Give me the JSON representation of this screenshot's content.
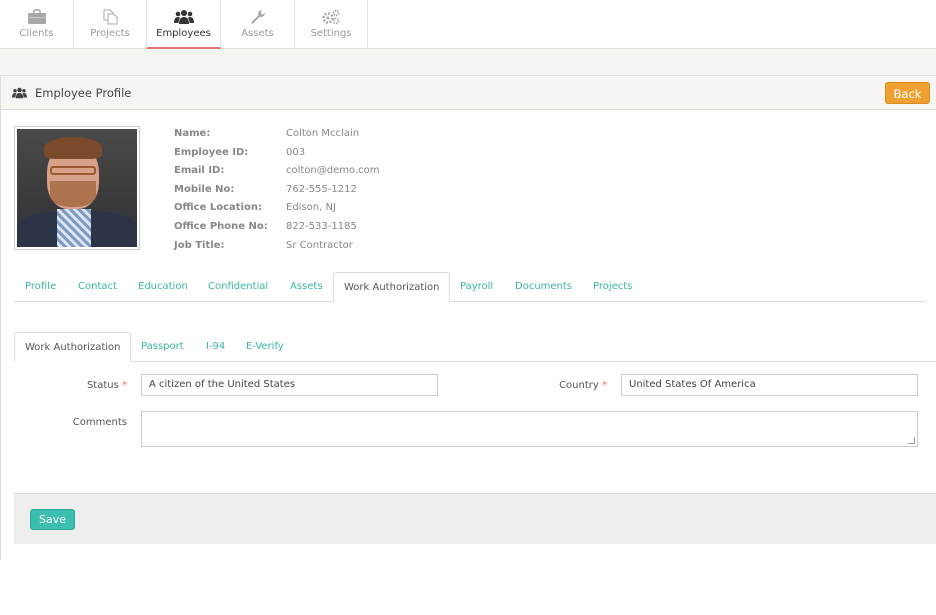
{
  "topnav": {
    "items": [
      {
        "label": "Clients",
        "icon": "briefcase-icon",
        "active": false
      },
      {
        "label": "Projects",
        "icon": "copy-icon",
        "active": false
      },
      {
        "label": "Employees",
        "icon": "users-icon",
        "active": true
      },
      {
        "label": "Assets",
        "icon": "wrench-icon",
        "active": false
      },
      {
        "label": "Settings",
        "icon": "gears-icon",
        "active": false
      }
    ]
  },
  "panel": {
    "title": "Employee Profile",
    "back_label": "Back"
  },
  "profile": {
    "fields": [
      {
        "label": "Name:",
        "value": "Colton Mcclain"
      },
      {
        "label": "Employee ID:",
        "value": "003"
      },
      {
        "label": "Email ID:",
        "value": "colton@demo.com"
      },
      {
        "label": "Mobile No:",
        "value": "762-555-1212"
      },
      {
        "label": "Office Location:",
        "value": "Edison, NJ"
      },
      {
        "label": "Office Phone No:",
        "value": "822-533-1185"
      },
      {
        "label": "Job Title:",
        "value": "Sr Contractor"
      }
    ]
  },
  "tabs": [
    {
      "label": "Profile"
    },
    {
      "label": "Contact"
    },
    {
      "label": "Education"
    },
    {
      "label": "Confidential"
    },
    {
      "label": "Assets"
    },
    {
      "label": "Work Authorization",
      "active": true
    },
    {
      "label": "Payroll"
    },
    {
      "label": "Documents"
    },
    {
      "label": "Projects"
    }
  ],
  "subtabs": [
    {
      "label": "Work Authorization",
      "active": true
    },
    {
      "label": "Passport"
    },
    {
      "label": "I-94"
    },
    {
      "label": "E-Verify"
    }
  ],
  "form": {
    "status_label": "Status",
    "status_value": "A citizen of the United States",
    "country_label": "Country",
    "country_value": "United States Of America",
    "comments_label": "Comments",
    "comments_value": "",
    "required_mark": "*",
    "save_label": "Save"
  },
  "colors": {
    "accent_teal": "#3cbfae",
    "back_orange": "#f0a030",
    "active_tab_underline": "#e57373"
  }
}
